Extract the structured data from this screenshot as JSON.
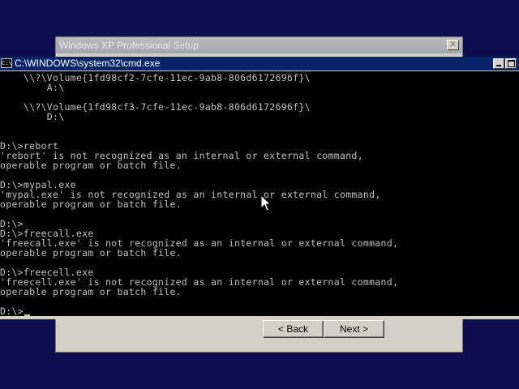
{
  "setup_window": {
    "title": "Windows XP Professional Setup",
    "close_glyph": "✕",
    "back_label": "< Back",
    "next_label": "Next >"
  },
  "cmd_window": {
    "icon_label": "C:\\",
    "title": "C:\\WINDOWS\\system32\\cmd.exe",
    "lines": [
      "    \\\\?\\Volume{1fd98cf2-7cfe-11ec-9ab8-806d6172696f}\\",
      "        A:\\",
      "",
      "    \\\\?\\Volume{1fd98cf3-7cfe-11ec-9ab8-806d6172696f}\\",
      "        D:\\",
      "",
      "",
      "D:\\>rebort",
      "'rebort' is not recognized as an internal or external command,",
      "operable program or batch file.",
      "",
      "D:\\>mypal.exe",
      "'mypal.exe' is not recognized as an internal or external command,",
      "operable program or batch file.",
      "",
      "D:\\>",
      "D:\\>freecall.exe",
      "'freecall.exe' is not recognized as an internal or external command,",
      "operable program or batch file.",
      "",
      "D:\\>freecell.exe",
      "'freecell.exe' is not recognized as an internal or external command,",
      "operable program or batch file.",
      "",
      "D:\\>"
    ]
  },
  "colors": {
    "desktop": "#0d0e4e",
    "title_active": "#0a246a",
    "console_bg": "#000000",
    "console_fg": "#c0c0c0"
  },
  "icons": {
    "cmd_icon": "cmd-system-icon",
    "minimize": "minimize-icon",
    "maximize": "maximize-icon",
    "pointer": "mouse-pointer-icon"
  }
}
